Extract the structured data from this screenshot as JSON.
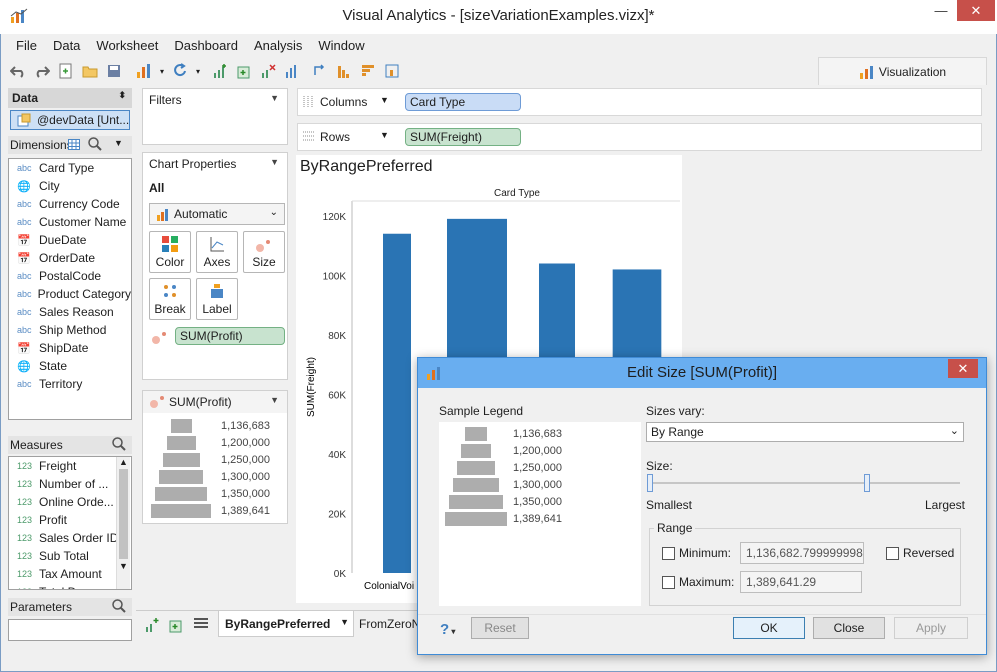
{
  "window": {
    "title": "Visual Analytics - [sizeVariationExamples.vizx]*",
    "min": "—",
    "max": "☐",
    "close": "✕"
  },
  "menu": [
    "File",
    "Data",
    "Worksheet",
    "Dashboard",
    "Analysis",
    "Window"
  ],
  "viz_tab": {
    "label": "Visualization"
  },
  "data_pane": {
    "header": "Data",
    "datasource": "@devData [Unt...",
    "dimensions_label": "Dimensions",
    "dimensions": [
      {
        "type": "abc",
        "name": "Card Type"
      },
      {
        "type": "geo",
        "name": "City"
      },
      {
        "type": "abc",
        "name": "Currency Code"
      },
      {
        "type": "abc",
        "name": "Customer Name"
      },
      {
        "type": "date",
        "name": "DueDate"
      },
      {
        "type": "date",
        "name": "OrderDate"
      },
      {
        "type": "abc",
        "name": "PostalCode"
      },
      {
        "type": "abc",
        "name": "Product Category"
      },
      {
        "type": "abc",
        "name": "Sales Reason"
      },
      {
        "type": "abc",
        "name": "Ship Method"
      },
      {
        "type": "date",
        "name": "ShipDate"
      },
      {
        "type": "geo",
        "name": "State"
      },
      {
        "type": "abc",
        "name": "Territory"
      }
    ],
    "measures_label": "Measures",
    "measures": [
      {
        "type": "123",
        "name": "Freight"
      },
      {
        "type": "123",
        "name": "Number of ..."
      },
      {
        "type": "123",
        "name": "Online Orde..."
      },
      {
        "type": "123",
        "name": "Profit"
      },
      {
        "type": "123",
        "name": "Sales Order ID"
      },
      {
        "type": "123",
        "name": "Sub Total"
      },
      {
        "type": "123",
        "name": "Tax Amount"
      },
      {
        "type": "123",
        "name": "Total Due"
      }
    ],
    "parameters_label": "Parameters"
  },
  "filters": {
    "title": "Filters"
  },
  "chart_properties": {
    "title": "Chart Properties",
    "tab": "All",
    "mark_type": "Automatic",
    "buttons": [
      "Color",
      "Axes",
      "Size",
      "Break",
      "Label"
    ],
    "size_pill": "SUM(Profit)"
  },
  "size_legend": {
    "title": "SUM(Profit)",
    "values": [
      "1,136,683",
      "1,200,000",
      "1,250,000",
      "1,300,000",
      "1,350,000",
      "1,389,641"
    ]
  },
  "shelves": {
    "columns_label": "Columns",
    "columns_pill": "Card Type",
    "rows_label": "Rows",
    "rows_pill": "SUM(Freight)"
  },
  "sheet": {
    "title": "ByRangePreferred",
    "col_header": "Card Type",
    "y_axis_label": "SUM(Freight)",
    "y_ticks": [
      "120K",
      "100K",
      "80K",
      "60K",
      "40K",
      "20K",
      "0K"
    ],
    "first_category": "ColonialVoi"
  },
  "chart_data": {
    "type": "bar",
    "title": "ByRangePreferred",
    "xlabel": "Card Type",
    "ylabel": "SUM(Freight)",
    "ylim": [
      0,
      125000
    ],
    "categories": [
      "ColonialVoi",
      "",
      "",
      ""
    ],
    "values": [
      114000,
      119000,
      104000,
      102000
    ],
    "size_profit": [
      1136683,
      1389641,
      1200000,
      1300000
    ],
    "color": "#2a74b4",
    "grid": false
  },
  "bottom_tabs": {
    "active": "ByRangePreferred",
    "next": "FromZeroNo"
  },
  "dialog": {
    "title": "Edit Size [SUM(Profit)]",
    "sample_legend_label": "Sample Legend",
    "legend_values": [
      "1,136,683",
      "1,200,000",
      "1,250,000",
      "1,300,000",
      "1,350,000",
      "1,389,641"
    ],
    "sizes_vary_label": "Sizes vary:",
    "sizes_vary_value": "By Range",
    "size_label": "Size:",
    "smallest": "Smallest",
    "largest": "Largest",
    "slider_min": 0.0,
    "slider_max": 0.7,
    "range_label": "Range",
    "minimum_label": "Minimum:",
    "minimum_value": "1,136,682.799999998",
    "maximum_label": "Maximum:",
    "maximum_value": "1,389,641.29",
    "reversed_label": "Reversed",
    "help": "?",
    "reset": "Reset",
    "ok": "OK",
    "close": "Close",
    "apply": "Apply"
  }
}
